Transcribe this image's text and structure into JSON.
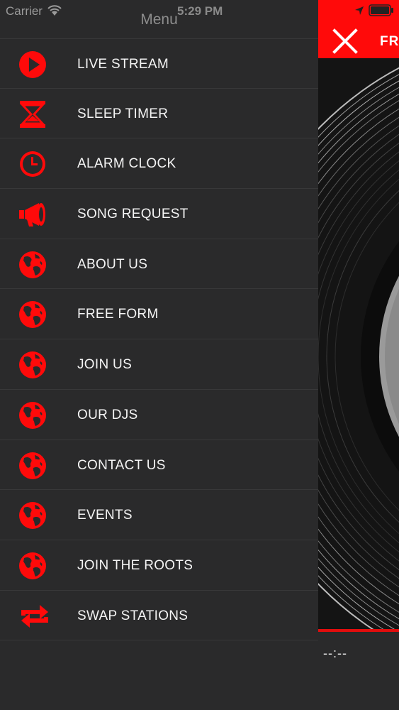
{
  "status_bar": {
    "carrier": "Carrier",
    "time": "5:29 PM"
  },
  "drawer": {
    "title": "Menu",
    "items": [
      {
        "label": "LIVE STREAM",
        "icon": "play-circle-icon"
      },
      {
        "label": "SLEEP TIMER",
        "icon": "hourglass-icon"
      },
      {
        "label": "ALARM CLOCK",
        "icon": "clock-icon"
      },
      {
        "label": "SONG REQUEST",
        "icon": "megaphone-icon"
      },
      {
        "label": "ABOUT US",
        "icon": "globe-icon"
      },
      {
        "label": "FREE FORM",
        "icon": "globe-icon"
      },
      {
        "label": "JOIN US",
        "icon": "globe-icon"
      },
      {
        "label": "OUR DJS",
        "icon": "globe-icon"
      },
      {
        "label": "CONTACT US",
        "icon": "globe-icon"
      },
      {
        "label": "EVENTS",
        "icon": "globe-icon"
      },
      {
        "label": "JOIN THE ROOTS",
        "icon": "globe-icon"
      },
      {
        "label": "SWAP STATIONS",
        "icon": "swap-arrows-icon"
      }
    ]
  },
  "main": {
    "title_fragment": "FR",
    "time_display": "--:--"
  },
  "colors": {
    "accent": "#ff0a0a",
    "drawer_bg": "#2a2a2b",
    "text": "#f4f4f4"
  }
}
